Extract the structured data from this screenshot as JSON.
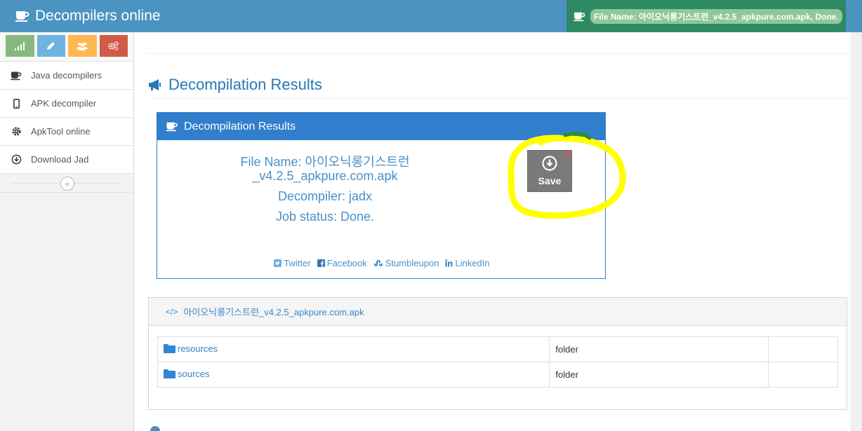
{
  "app": {
    "title": "Decompilers online",
    "status_text": "File Name: 아이오닉롱기스트런_v4.2.5_apkpure.com.apk, Done."
  },
  "sidebar": {
    "items": [
      {
        "label": "Java decompilers",
        "icon": "coffee-icon"
      },
      {
        "label": "APK decompiler",
        "icon": "mobile-icon"
      },
      {
        "label": "ApkTool online",
        "icon": "gear-icon"
      },
      {
        "label": "Download Jad",
        "icon": "download-icon"
      }
    ]
  },
  "page": {
    "header": "Decompilation Results"
  },
  "widget": {
    "title": "Decompilation Results",
    "file_name_line1": "File Name: 아이오닉롱기스트런",
    "file_name_line2": "_v4.2.5_apkpure.com.apk",
    "decompiler": "Decompiler: jadx",
    "job_status": "Job status: Done.",
    "save_label": "Save",
    "shares": [
      "Twitter",
      "Facebook",
      "Stumbleupon",
      "LinkedIn"
    ]
  },
  "filebox": {
    "title": "아이오닉롱기스트런_v4.2.5_apkpure.com.apk",
    "rows": [
      {
        "name": "resources",
        "type": "folder"
      },
      {
        "name": "sources",
        "type": "folder"
      }
    ]
  },
  "colors": {
    "topbar": "#4b94c2",
    "status_bg": "#2e8a62",
    "widget_header": "#307ecc",
    "highlight": "#ffff00"
  }
}
